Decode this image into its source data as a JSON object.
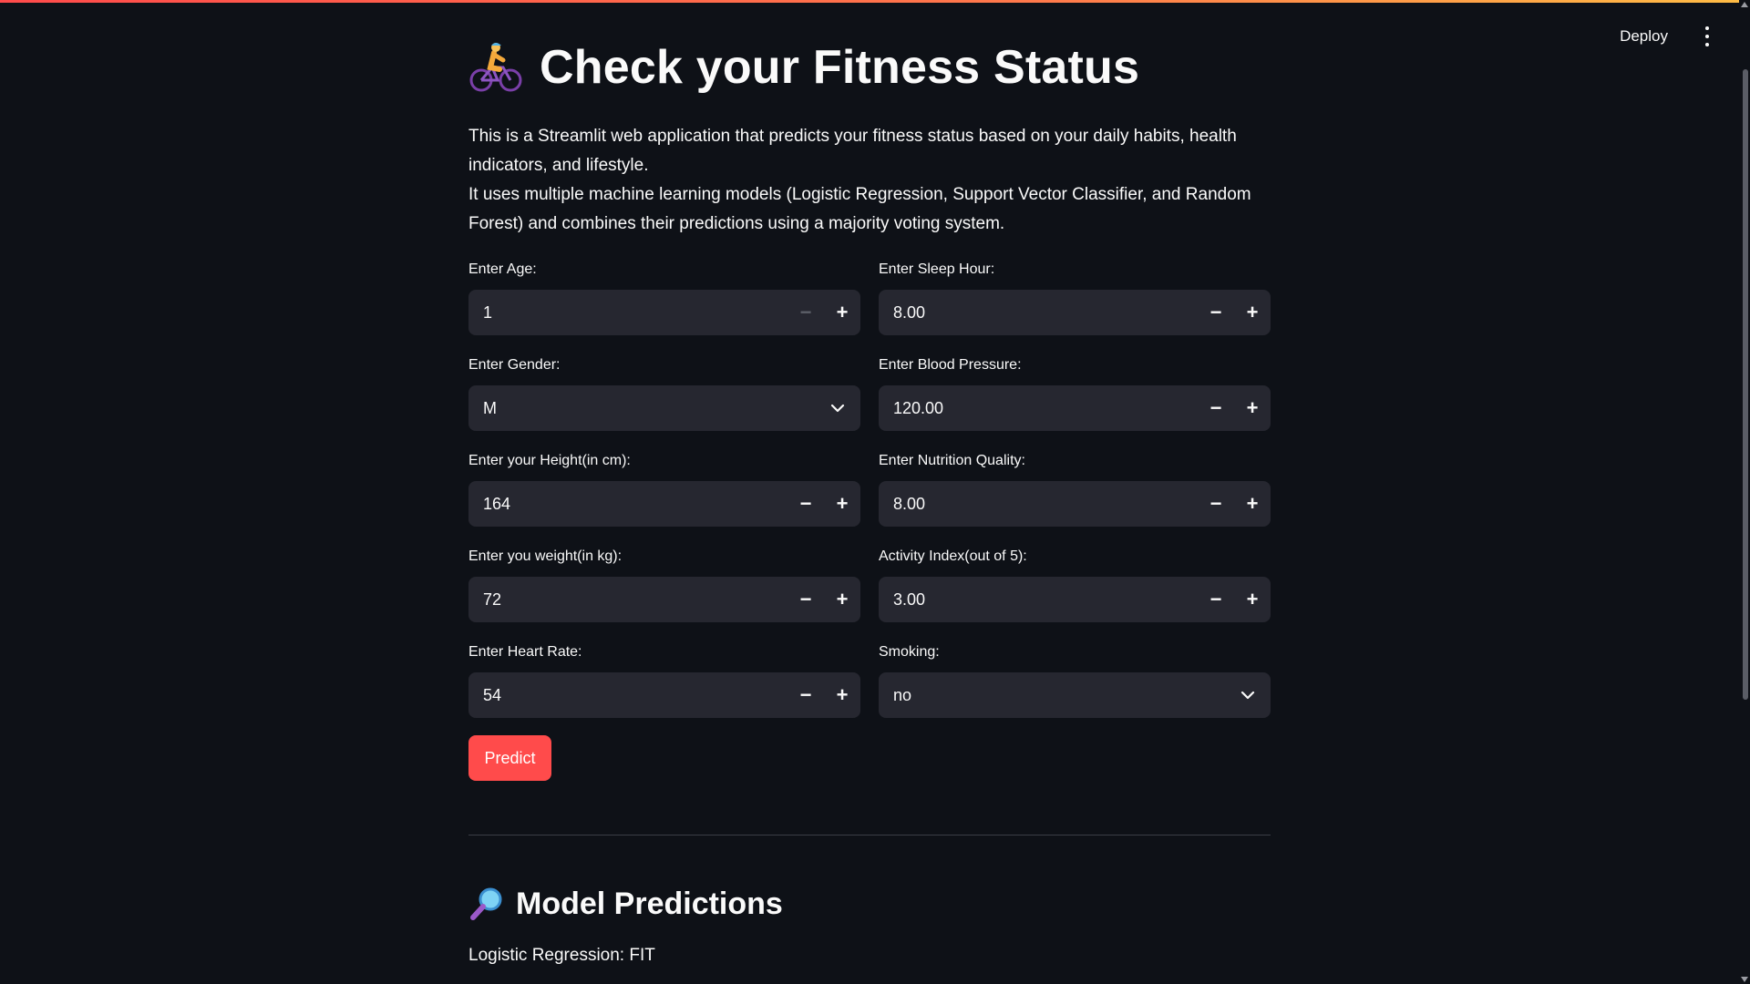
{
  "header": {
    "deploy_label": "Deploy",
    "menu_icon": "more-vertical-icon"
  },
  "colors": {
    "background": "#0e1117",
    "input_background": "#262730",
    "accent": "#ff4b4b"
  },
  "title": {
    "emoji": "person-biking-icon",
    "text": "Check your Fitness Status"
  },
  "description": {
    "line1": "This is a Streamlit web application that predicts your fitness status based on your daily habits, health indicators, and lifestyle.",
    "line2": "It uses multiple machine learning models (Logistic Regression, Support Vector Classifier, and Random Forest) and combines their predictions using a majority voting system."
  },
  "form": {
    "age": {
      "label": "Enter Age:",
      "value": "1"
    },
    "gender": {
      "label": "Enter Gender:",
      "value": "M"
    },
    "height": {
      "label": "Enter your Height(in cm):",
      "value": "164"
    },
    "weight": {
      "label": "Enter you weight(in kg):",
      "value": "72"
    },
    "heart_rate": {
      "label": "Enter Heart Rate:",
      "value": "54"
    },
    "sleep": {
      "label": "Enter Sleep Hour:",
      "value": "8.00"
    },
    "blood_pressure": {
      "label": "Enter Blood Pressure:",
      "value": "120.00"
    },
    "nutrition": {
      "label": "Enter Nutrition Quality:",
      "value": "8.00"
    },
    "activity": {
      "label": "Activity Index(out of 5):",
      "value": "3.00"
    },
    "smoking": {
      "label": "Smoking:",
      "value": "no"
    },
    "minus": "−",
    "plus": "+"
  },
  "predict_label": "Predict",
  "predictions": {
    "emoji": "magnifying-glass-icon",
    "title": "Model Predictions",
    "logistic": "Logistic Regression: FIT"
  }
}
